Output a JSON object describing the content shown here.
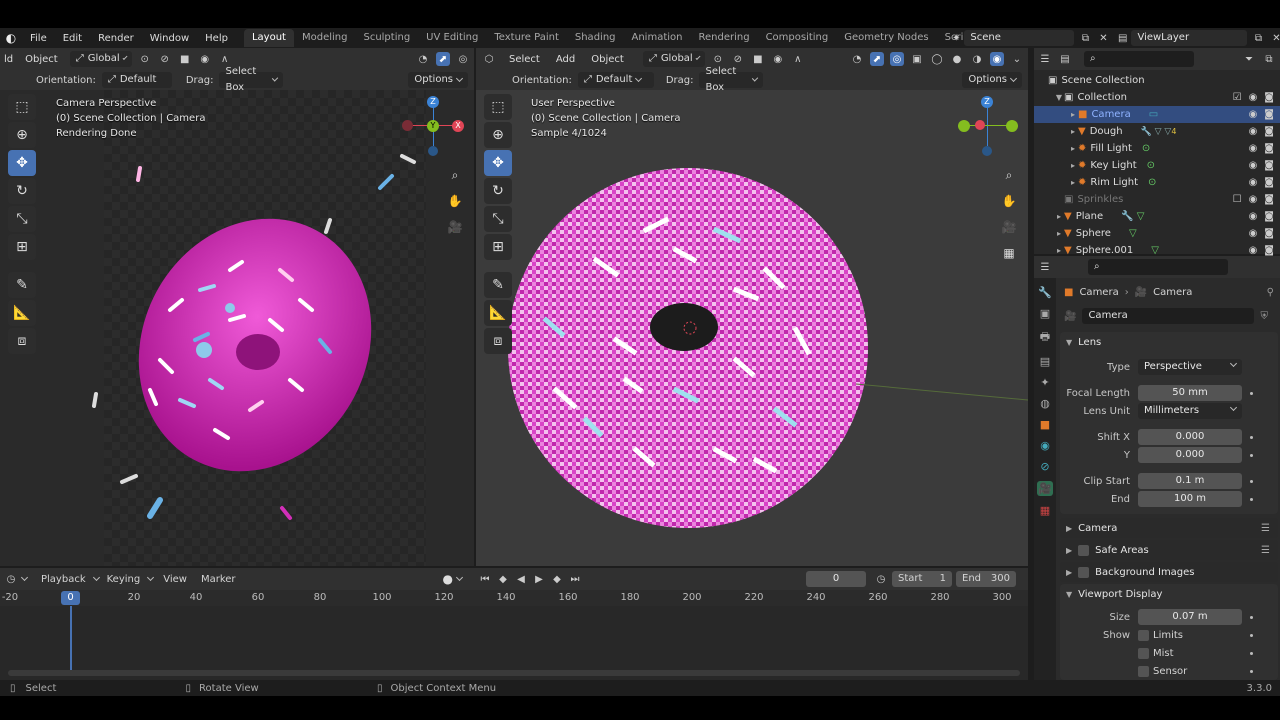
{
  "topbar": {
    "menus": [
      "File",
      "Edit",
      "Render",
      "Window",
      "Help"
    ],
    "workspaces": [
      "Layout",
      "Modeling",
      "Sculpting",
      "UV Editing",
      "Texture Paint",
      "Shading",
      "Animation",
      "Rendering",
      "Compositing",
      "Geometry Nodes",
      "Scripting"
    ],
    "active_workspace": "Layout",
    "add_tab": "+",
    "scene": "Scene",
    "view_layer": "ViewLayer"
  },
  "left_view": {
    "header_left": "ld",
    "object_menu": "Object",
    "transform": "Global",
    "orientation_label": "Orientation:",
    "orientation_value": "Default",
    "drag_label": "Drag:",
    "drag_value": "Select Box",
    "options": "Options",
    "overlay_line1": "Camera Perspective",
    "overlay_line2": "(0) Scene Collection | Camera",
    "overlay_line3": "Rendering Done"
  },
  "right_view": {
    "menus": [
      "Select",
      "Add",
      "Object"
    ],
    "transform": "Global",
    "orientation_label": "Orientation:",
    "orientation_value": "Default",
    "drag_label": "Drag:",
    "drag_value": "Select Box",
    "options": "Options",
    "overlay_line1": "User Perspective",
    "overlay_line2": "(0) Scene Collection | Camera",
    "overlay_line3": "Sample 4/1024"
  },
  "gizmo": {
    "x": "X",
    "y": "Y",
    "z": "Z"
  },
  "outliner": {
    "root": "Scene Collection",
    "items": [
      {
        "label": "Collection",
        "indent": 1
      },
      {
        "label": "Camera",
        "indent": 2,
        "selected": true
      },
      {
        "label": "Dough",
        "indent": 2
      },
      {
        "label": "Fill Light",
        "indent": 2
      },
      {
        "label": "Key Light",
        "indent": 2
      },
      {
        "label": "Rim Light",
        "indent": 2
      },
      {
        "label": "Sprinkles",
        "indent": 1,
        "dim": true
      },
      {
        "label": "Plane",
        "indent": 1
      },
      {
        "label": "Sphere",
        "indent": 1
      },
      {
        "label": "Sphere.001",
        "indent": 1
      }
    ],
    "dough_badge": "4"
  },
  "properties": {
    "breadcrumb1": "Camera",
    "breadcrumb2": "Camera",
    "datablock": "Camera",
    "lens_section": "Lens",
    "type_label": "Type",
    "type_value": "Perspective",
    "focal_label": "Focal Length",
    "focal_value": "50 mm",
    "lensunit_label": "Lens Unit",
    "lensunit_value": "Millimeters",
    "shiftx_label": "Shift X",
    "shiftx_value": "0.000",
    "shifty_label": "Y",
    "shifty_value": "0.000",
    "clipstart_label": "Clip Start",
    "clipstart_value": "0.1 m",
    "clipend_label": "End",
    "clipend_value": "100 m",
    "camera_section": "Camera",
    "safe_section": "Safe Areas",
    "bg_section": "Background Images",
    "vd_section": "Viewport Display",
    "size_label": "Size",
    "size_value": "0.07 m",
    "show_label": "Show",
    "limits": "Limits",
    "mist": "Mist",
    "sensor": "Sensor"
  },
  "timeline": {
    "menus": [
      "Playback",
      "Keying",
      "View",
      "Marker"
    ],
    "current_frame": "0",
    "start_label": "Start",
    "start_value": "1",
    "end_label": "End",
    "end_value": "300",
    "ticks": [
      "-20",
      "0",
      "20",
      "40",
      "60",
      "80",
      "100",
      "120",
      "140",
      "160",
      "180",
      "200",
      "220",
      "240",
      "260",
      "280",
      "300"
    ],
    "playhead": "0"
  },
  "statusbar": {
    "select": "Select",
    "rotate": "Rotate View",
    "context": "Object Context Menu",
    "version": "3.3.0"
  },
  "colors": {
    "accent": "#4772b3",
    "donut_pink": "#d22fb8",
    "x_axis": "#e04556",
    "y_axis": "#84bd1f",
    "z_axis": "#3b83d6"
  }
}
